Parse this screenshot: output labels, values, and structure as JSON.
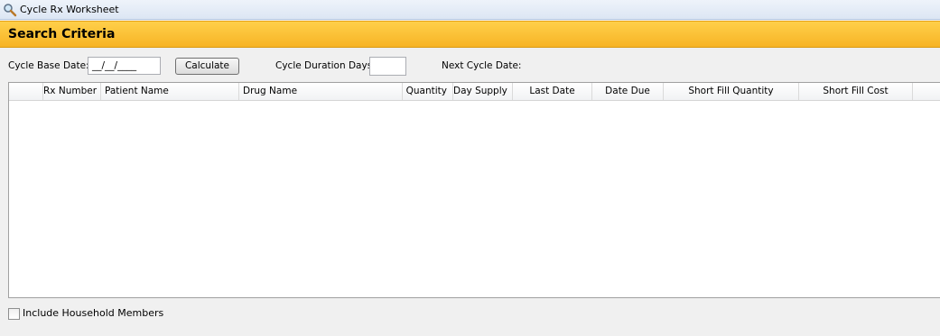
{
  "window": {
    "title": "Cycle Rx Worksheet"
  },
  "banner": {
    "title": "Search Criteria"
  },
  "criteria": {
    "base_date_label": "Cycle Base Date:",
    "base_date_value": "__/__/____",
    "calculate_label": "Calculate",
    "duration_label": "Cycle Duration Days:",
    "duration_value": "",
    "next_cycle_label": "Next Cycle Date:"
  },
  "table": {
    "columns": [
      "",
      "Rx Number",
      "Patient Name",
      "Drug Name",
      "Quantity",
      "Day Supply",
      "Last Date",
      "Date Due",
      "Short Fill Quantity",
      "Short Fill Cost"
    ],
    "rows": []
  },
  "footer": {
    "household_label": "Include Household Members",
    "household_checked": false
  }
}
